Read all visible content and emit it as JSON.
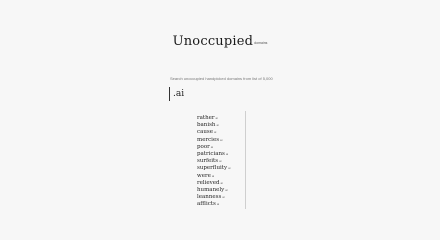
{
  "brand": {
    "name": "Unoccupied",
    "subtitle": "domains"
  },
  "tagline": "Search unoccupied handpicked domains from list of 5,000",
  "search": {
    "value": ".ai",
    "placeholder": ""
  },
  "results": [
    {
      "word": "rather",
      "tld": "ai"
    },
    {
      "word": "banish",
      "tld": "ai"
    },
    {
      "word": "cause",
      "tld": "ai"
    },
    {
      "word": "mercies",
      "tld": "ai"
    },
    {
      "word": "poor",
      "tld": "ai"
    },
    {
      "word": "patricians",
      "tld": "ai"
    },
    {
      "word": "surfeits",
      "tld": "ai"
    },
    {
      "word": "superfluity",
      "tld": "ai"
    },
    {
      "word": "were",
      "tld": "ai"
    },
    {
      "word": "relieved",
      "tld": "ai"
    },
    {
      "word": "humanely",
      "tld": "ai"
    },
    {
      "word": "leanness",
      "tld": "ai"
    },
    {
      "word": "afflicts",
      "tld": "ai"
    }
  ]
}
